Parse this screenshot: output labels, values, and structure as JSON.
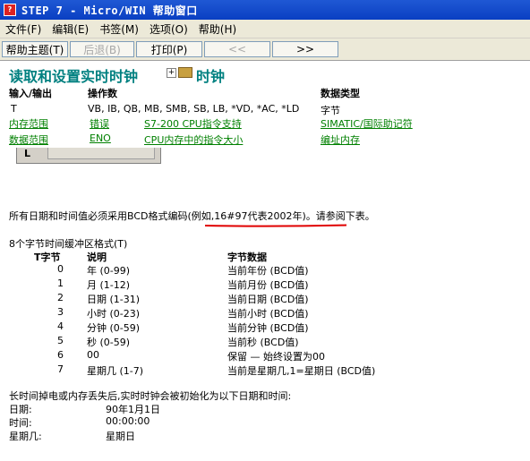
{
  "window": {
    "title": "STEP 7 - Micro/WIN 帮助窗口"
  },
  "menu": [
    "文件(F)",
    "编辑(E)",
    "书签(M)",
    "选项(O)",
    "帮助(H)"
  ],
  "toolbar": {
    "help_topics": "帮助主题(T)",
    "back": "后退(B)",
    "print": "打印(P)",
    "prev": "<<",
    "next": ">>"
  },
  "header": {
    "title": "读取和设置实时时钟",
    "topic": "时钟",
    "col_io": "输入/输出",
    "col_operands": "操作数",
    "col_datatype": "数据类型",
    "row1_io": "T",
    "row1_operands": "VB, IB, QB, MB, SMB, SB, LB, *VD, *AC, *LD",
    "row1_datatype": "字节",
    "link_mem_range": "内存范围",
    "link_errors": "错误",
    "link_s7200": "S7-200 CPU指令支持",
    "link_simatic": "SIMATIC/国际助记符",
    "link_data_range": "数据范围",
    "link_eno": "ENO",
    "link_cpu_mem": "CPU内存中的指令大小",
    "link_addr_mem": "编址内存"
  },
  "diagram": {
    "label": "L"
  },
  "body": {
    "bcd_note_pre": "所有日期和时间值必须采用BCD格式编码",
    "bcd_note_example": "(例如,16#97代表2002年)",
    "bcd_note_post": "。请参阅下表。",
    "buffer_title": "8个字节时间缓冲区格式(T)",
    "col_tbyte": "T字节",
    "col_desc": "说明",
    "col_data": "字节数据",
    "rows": [
      {
        "n": "0",
        "desc": "年 (0-99)",
        "data": "当前年份 (BCD值)"
      },
      {
        "n": "1",
        "desc": "月 (1-12)",
        "data": "当前月份 (BCD值)"
      },
      {
        "n": "2",
        "desc": "日期 (1-31)",
        "data": "当前日期 (BCD值)"
      },
      {
        "n": "3",
        "desc": "小时 (0-23)",
        "data": "当前小时 (BCD值)"
      },
      {
        "n": "4",
        "desc": "分钟 (0-59)",
        "data": "当前分钟 (BCD值)"
      },
      {
        "n": "5",
        "desc": "秒 (0-59)",
        "data": "当前秒 (BCD值)"
      },
      {
        "n": "6",
        "desc": "00",
        "data": "保留 — 始终设置为00"
      },
      {
        "n": "7",
        "desc": "星期几 (1-7)",
        "data": "当前是星期几,1=星期日 (BCD值)"
      }
    ],
    "power_loss_note": "长时间掉电或内存丢失后,实时时钟会被初始化为以下日期和时间:",
    "init": [
      {
        "label": "日期:",
        "value": "90年1月1日"
      },
      {
        "label": "时间:",
        "value": "00:00:00"
      },
      {
        "label": "星期几:",
        "value": "星期日"
      }
    ]
  },
  "colors": {
    "titlebar": "#0a3fc2",
    "heading": "#008080",
    "link": "#008000",
    "underline": "#e00000"
  }
}
